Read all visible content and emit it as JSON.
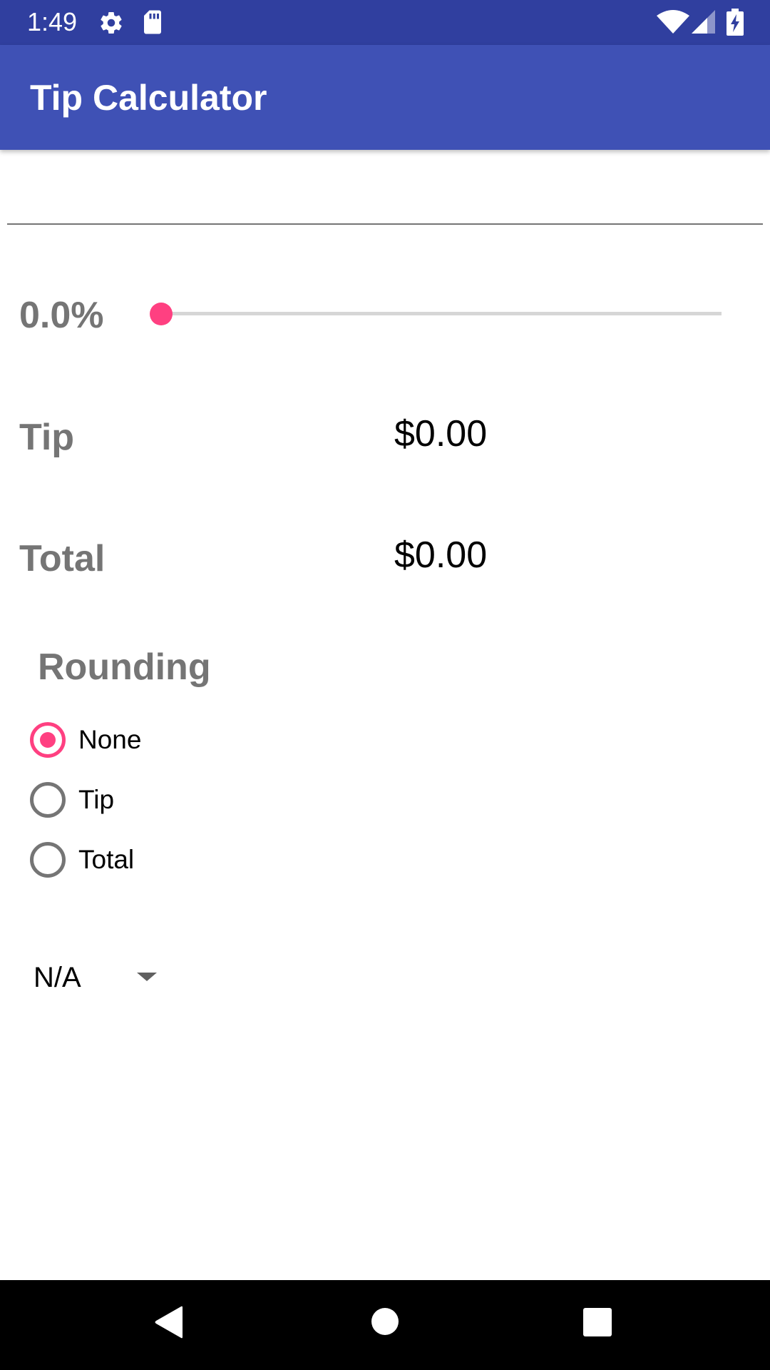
{
  "status_bar": {
    "time": "1:49",
    "icons": [
      "gear-icon",
      "sd-card-icon",
      "wifi-icon",
      "signal-icon",
      "battery-charging-icon"
    ]
  },
  "app_bar": {
    "title": "Tip Calculator"
  },
  "bill_input": {
    "value": "",
    "placeholder": ""
  },
  "tip_percent": {
    "label": "0.0%",
    "slider_value": 0
  },
  "tip_row": {
    "label": "Tip",
    "value": "$0.00"
  },
  "total_row": {
    "label": "Total",
    "value": "$0.00"
  },
  "rounding": {
    "title": "Rounding",
    "options": [
      {
        "label": "None",
        "checked": true
      },
      {
        "label": "Tip",
        "checked": false
      },
      {
        "label": "Total",
        "checked": false
      }
    ]
  },
  "spinner": {
    "selected": "N/A"
  },
  "nav_bar": {
    "buttons": [
      "back-icon",
      "home-icon",
      "recents-icon"
    ]
  },
  "colors": {
    "primary": "#3F51B5",
    "primary_dark": "#303F9F",
    "accent": "#FF4081",
    "label_gray": "#757575"
  }
}
